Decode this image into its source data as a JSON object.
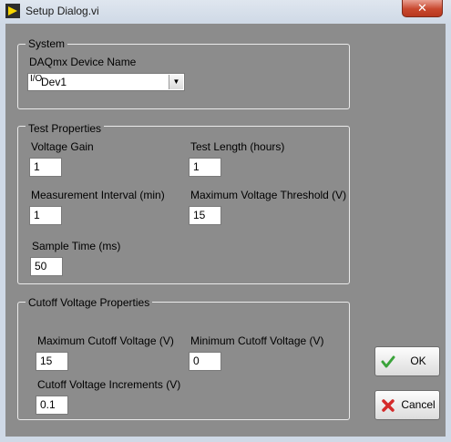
{
  "window": {
    "title": "Setup Dialog.vi",
    "close_glyph": "✕"
  },
  "system": {
    "group_title": "System",
    "device_label": "DAQmx Device Name",
    "device_value": "Dev1",
    "io_icon": "I/O",
    "dropdown_arrow": "▼"
  },
  "test": {
    "group_title": "Test Properties",
    "voltage_gain_label": "Voltage Gain",
    "voltage_gain_value": "1",
    "test_length_label": "Test Length (hours)",
    "test_length_value": "1",
    "interval_label": "Measurement Interval (min)",
    "interval_value": "1",
    "max_threshold_label": "Maximum Voltage Threshold (V)",
    "max_threshold_value": "15",
    "sample_time_label": "Sample Time (ms)",
    "sample_time_value": "50"
  },
  "cutoff": {
    "group_title": "Cutoff Voltage Properties",
    "max_label": "Maximum Cutoff Voltage (V)",
    "max_value": "15",
    "min_label": "Minimum Cutoff Voltage (V)",
    "min_value": "0",
    "increments_label": "Cutoff Voltage Increments (V)",
    "increments_value": "0.1"
  },
  "buttons": {
    "ok_label": "OK",
    "cancel_label": "Cancel"
  },
  "colors": {
    "panel_background": "#8c8c8c",
    "ok_check": "#3aa33a",
    "cancel_x": "#d42a2a"
  },
  "icons": {
    "app": "labview-vi-icon",
    "ok": "checkmark-icon",
    "cancel": "red-x-icon",
    "close": "close-icon"
  }
}
